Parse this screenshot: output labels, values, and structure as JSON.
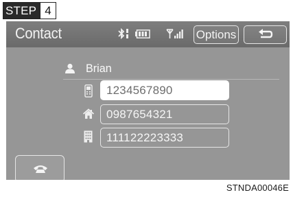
{
  "step": {
    "label": "STEP",
    "number": "4"
  },
  "screen": {
    "title": "Contact",
    "status_icons": [
      "bluetooth-icon",
      "battery-icon",
      "signal-icon"
    ],
    "options_label": "Options",
    "back_icon": "back-arrow-icon",
    "contact": {
      "icon": "person-icon",
      "name": "Brian",
      "numbers": [
        {
          "type_icon": "mobile-phone-icon",
          "value": "1234567890",
          "selected": true
        },
        {
          "type_icon": "home-icon",
          "value": "0987654321",
          "selected": false
        },
        {
          "type_icon": "office-building-icon",
          "value": "111122223333",
          "selected": false
        }
      ]
    },
    "call_icon": "phone-handset-icon"
  },
  "figure_code": "STNDA00046E"
}
